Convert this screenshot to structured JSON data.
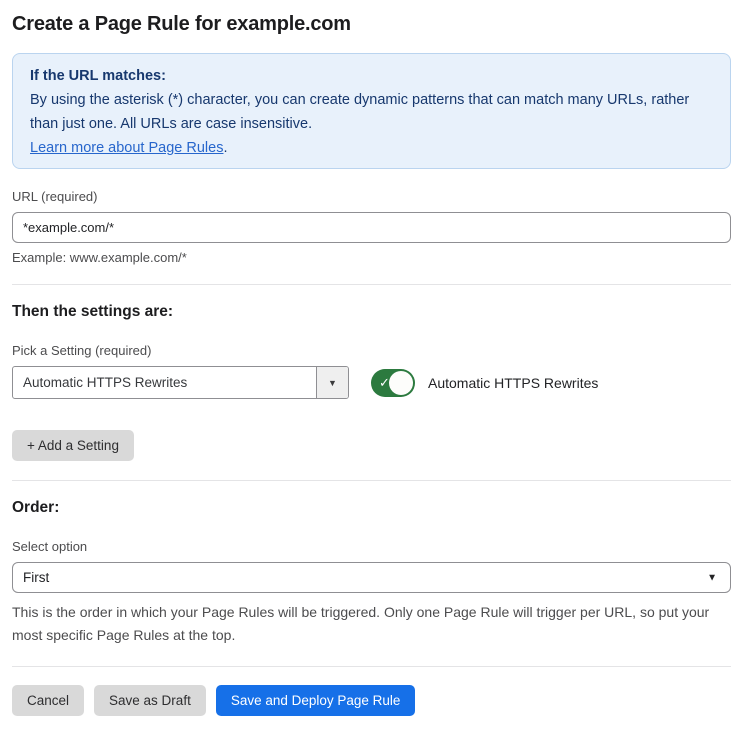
{
  "page": {
    "title": "Create a Page Rule for example.com"
  },
  "info_box": {
    "heading": "If the URL matches:",
    "body": "By using the asterisk (*) character, you can create dynamic patterns that can match many URLs, rather than just one. All URLs are case insensitive.",
    "link_label": "Learn more about Page Rules",
    "link_suffix": "."
  },
  "url_field": {
    "label": "URL (required)",
    "value": "*example.com/*",
    "hint": "Example: www.example.com/*"
  },
  "settings_section": {
    "heading": "Then the settings are:",
    "picker_label": "Pick a Setting (required)",
    "picker_value": "Automatic HTTPS Rewrites",
    "toggle_label": "Automatic HTTPS Rewrites",
    "toggle_state": "on",
    "add_setting_label": "+ Add a Setting"
  },
  "order_section": {
    "heading": "Order:",
    "select_label": "Select option",
    "select_value": "First",
    "help_text": "This is the order in which your Page Rules will be triggered. Only one Page Rule will trigger per URL, so put your most specific Page Rules at the top."
  },
  "footer": {
    "cancel_label": "Cancel",
    "save_draft_label": "Save as Draft",
    "save_deploy_label": "Save and Deploy Page Rule"
  },
  "icons": {
    "dropdown_arrow": "▼",
    "select_arrow": "▼",
    "toggle_check": "✓"
  },
  "colors": {
    "accent_blue": "#1670e8",
    "toggle_green": "#2c7a3f",
    "info_background": "#e8f1fb",
    "info_border": "#bad4ef",
    "info_text": "#17386e",
    "link_blue": "#2766cc",
    "button_gray": "#d9d9d9"
  }
}
